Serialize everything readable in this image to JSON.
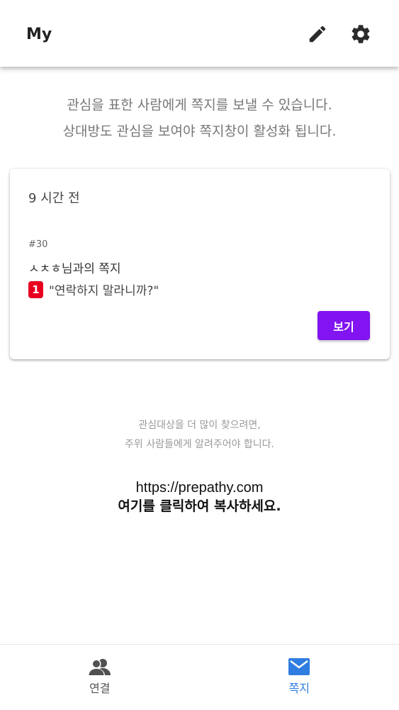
{
  "header": {
    "title": "My",
    "edit_icon": "pencil-icon",
    "settings_icon": "gear-icon"
  },
  "notice": {
    "line1": "관심을 표한 사람에게 쪽지를 보낼 수 있습니다.",
    "line2": "상대방도 관심을 보여야 쪽지창이 활성화 됩니다."
  },
  "card": {
    "time": "9 시간 전",
    "number": "#30",
    "chat_with": "ㅅㅊㅎ님과의 쪽지",
    "unread_count": "1",
    "last_message": "\"연락하지 말라니까?\"",
    "view_label": "보기"
  },
  "hint": {
    "line1": "관심대상을 더 많이 찾으려면,",
    "line2": "주위 사람들에게 알려주어야 합니다."
  },
  "share": {
    "url": "https://prepathy.com",
    "copy_text": "여기를 클릭하여 복사하세요."
  },
  "nav": {
    "connect_label": "연결",
    "message_label": "쪽지",
    "active": "message"
  },
  "colors": {
    "accent_purple": "#8114f0",
    "badge_red": "#e8001f",
    "nav_active_blue": "#2f7de1"
  }
}
